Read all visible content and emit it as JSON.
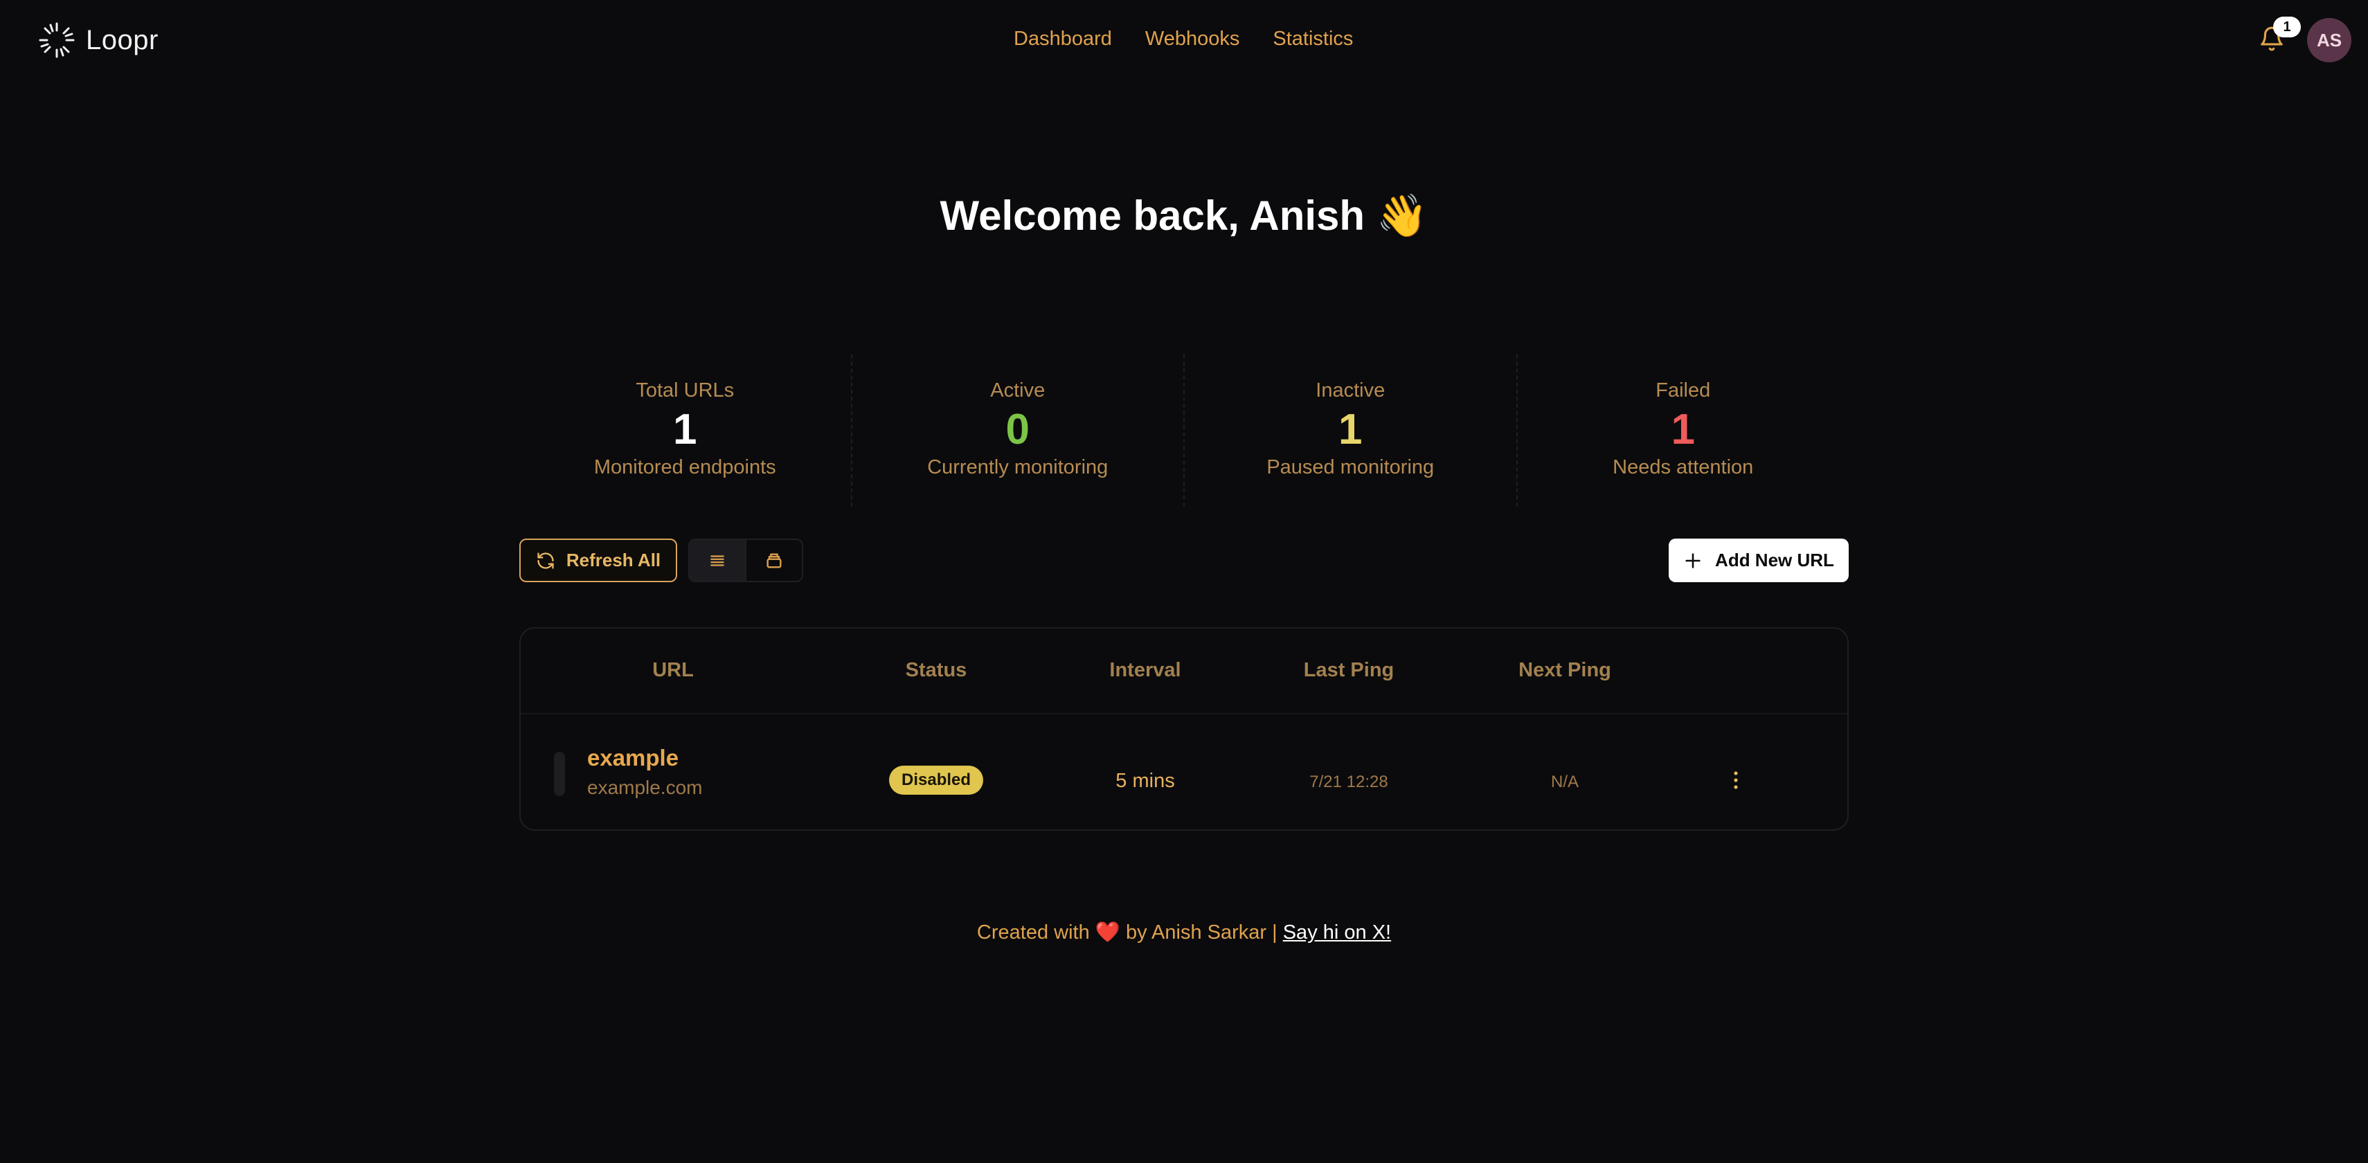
{
  "app": {
    "name": "Loopr"
  },
  "nav": {
    "items": [
      "Dashboard",
      "Webhooks",
      "Statistics"
    ]
  },
  "notifications": {
    "count": "1",
    "icon": "bell-icon"
  },
  "user": {
    "initials": "AS",
    "avatar_color": "#5a3448"
  },
  "welcome": {
    "text": "Welcome back, Anish 👋"
  },
  "stats": [
    {
      "label": "Total URLs",
      "value": "1",
      "sub": "Monitored endpoints",
      "color": "#ffffff"
    },
    {
      "label": "Active",
      "value": "0",
      "sub": "Currently monitoring",
      "color": "#7cc447"
    },
    {
      "label": "Inactive",
      "value": "1",
      "sub": "Paused monitoring",
      "color": "#e8d66a"
    },
    {
      "label": "Failed",
      "value": "1",
      "sub": "Needs attention",
      "color": "#ef5b5b"
    }
  ],
  "toolbar": {
    "refresh_label": "Refresh All",
    "add_label": "Add New URL",
    "views": [
      "list-view",
      "card-view"
    ],
    "active_view": "list-view"
  },
  "table": {
    "columns": [
      "URL",
      "Status",
      "Interval",
      "Last Ping",
      "Next Ping"
    ],
    "rows": [
      {
        "name": "example",
        "host": "example.com",
        "status": "Disabled",
        "interval": "5 mins",
        "last_ping": "7/21 12:28",
        "next_ping": "N/A"
      }
    ]
  },
  "footer": {
    "prefix": "Created with",
    "heart": "❤️",
    "middle": "by Anish Sarkar |",
    "link_label": "Say hi on X!"
  },
  "colors": {
    "accent": "#e0a24e",
    "background": "#0b0b0d",
    "status_disabled": "#e0c64e"
  }
}
